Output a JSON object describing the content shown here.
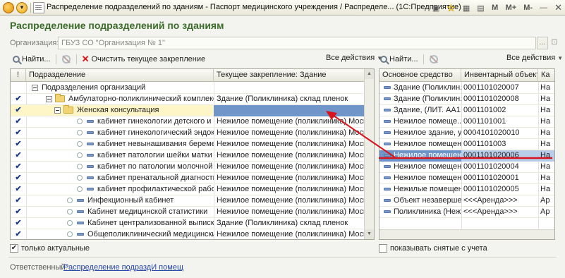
{
  "window": {
    "title": "Распределение подразделений по зданиям - Паспорт медицинского учреждения / Распределе... (1С:Предприятие)",
    "buttons": [
      "M",
      "M+",
      "M-"
    ]
  },
  "page_title": "Распределение подразделений по зданиям",
  "organization": {
    "label": "Организация:",
    "value": "ГБУЗ СО \"Организация № 1\"",
    "select_btn": "..."
  },
  "left_toolbar": {
    "find": "Найти...",
    "clear": "Очистить текущее закрепление",
    "all_actions": "Все действия"
  },
  "right_toolbar": {
    "find": "Найти...",
    "all_actions": "Все действия"
  },
  "left_grid": {
    "col_mark": "!",
    "col_division": "Подразделение",
    "col_building": "Текущее закрепление: Здание",
    "rows": [
      {
        "check": "",
        "icon": "minus",
        "name": "Подразделения организаций",
        "building": ""
      },
      {
        "check": "✔",
        "icon": "folder",
        "name": "Амбулаторно-поликлинический комплекс №1",
        "building": "Здание  (Поликлиника) склад пленок"
      },
      {
        "check": "✔",
        "icon": "folder",
        "name": "Женская консультация",
        "building": ""
      },
      {
        "check": "✔",
        "icon": "item",
        "name": "кабинет гинекологии детского и подр...",
        "building": "Нежилое   помещение   (поликлиника)   Моск..."
      },
      {
        "check": "✔",
        "icon": "item",
        "name": "кабинет гинекологический эндокрино...",
        "building": "Нежилое   помещение   (поликлиника)   Моск..."
      },
      {
        "check": "✔",
        "icon": "item",
        "name": "кабинет невынашивания беременности",
        "building": "Нежилое   помещение   (поликлиника)   Моск..."
      },
      {
        "check": "✔",
        "icon": "item",
        "name": "кабинет патологии шейки матки",
        "building": "Нежилое   помещение   (поликлиника)   Моск..."
      },
      {
        "check": "✔",
        "icon": "item",
        "name": "кабинет по патологии молочной железы",
        "building": "Нежилое   помещение   (поликлиника)   Моск..."
      },
      {
        "check": "✔",
        "icon": "item",
        "name": "кабинет пренатальной диагностики",
        "building": "Нежилое   помещение   (поликлиника)   Моск..."
      },
      {
        "check": "✔",
        "icon": "item",
        "name": "кабинет профилактической работы",
        "building": "Нежилое   помещение   (поликлиника)   Моск..."
      },
      {
        "check": "✔",
        "icon": "item2",
        "name": "Инфекционный кабинет",
        "building": "Нежилое   помещение   (поликлиника)   Моск..."
      },
      {
        "check": "✔",
        "icon": "item2",
        "name": "Кабинет медицинской статистики",
        "building": "Нежилое   помещение   (поликлиника)   Моск..."
      },
      {
        "check": "✔",
        "icon": "item2",
        "name": "Кабинет централизованной выписки реце...",
        "building": "Здание  (Поликлиника) склад пленок"
      },
      {
        "check": "✔",
        "icon": "item2",
        "name": "Общеполиклинический медицинский перс...",
        "building": "Нежилое   помещение   (поликлиника)   Моск..."
      }
    ]
  },
  "right_grid": {
    "col_asset": "Основное средство",
    "col_inventory": "Инвентарный объект",
    "col_extra": "Ка",
    "rows": [
      {
        "asset": "Здание  (Поликлин...",
        "inv": "0001101020007",
        "extra": "На"
      },
      {
        "asset": "Здание  (Поликлин...",
        "inv": "0001101020008",
        "extra": "На"
      },
      {
        "asset": "Здание, (ЛИТ. АА1...",
        "inv": "0001101002",
        "extra": "На"
      },
      {
        "asset": "Нежилое  помеще...",
        "inv": "0001101001",
        "extra": "На"
      },
      {
        "asset": "Нежилое здание, у...",
        "inv": "0004101020010",
        "extra": "На"
      },
      {
        "asset": "Нежилое помещен...",
        "inv": "0001101003",
        "extra": "На"
      },
      {
        "asset": "Нежилое помещен...",
        "inv": "0001101020006",
        "extra": "На"
      },
      {
        "asset": "Нежилое помещен...",
        "inv": "0001101020004",
        "extra": "На"
      },
      {
        "asset": "Нежилое помещен...",
        "inv": "0001101020001",
        "extra": "На"
      },
      {
        "asset": "Нежилые помещен...",
        "inv": "0001101020005",
        "extra": "На"
      },
      {
        "asset": "Объект незаверше...",
        "inv": "<<<Аренда>>>",
        "extra": "Ар"
      },
      {
        "asset": "Поликлиника (Неж...",
        "inv": "<<<Аренда>>>",
        "extra": "Ар"
      }
    ]
  },
  "only_current": {
    "label": "только актуальные",
    "checked": true
  },
  "show_removed": {
    "label": "показывать снятые с учета",
    "checked": false
  },
  "responsible": {
    "label": "Ответственный:",
    "link": "Распределение подраздИ помещ"
  },
  "colors": {
    "title_green": "#3b6d2a",
    "selection_blue": "#6f95c9",
    "annotation_red": "#d8141c"
  }
}
